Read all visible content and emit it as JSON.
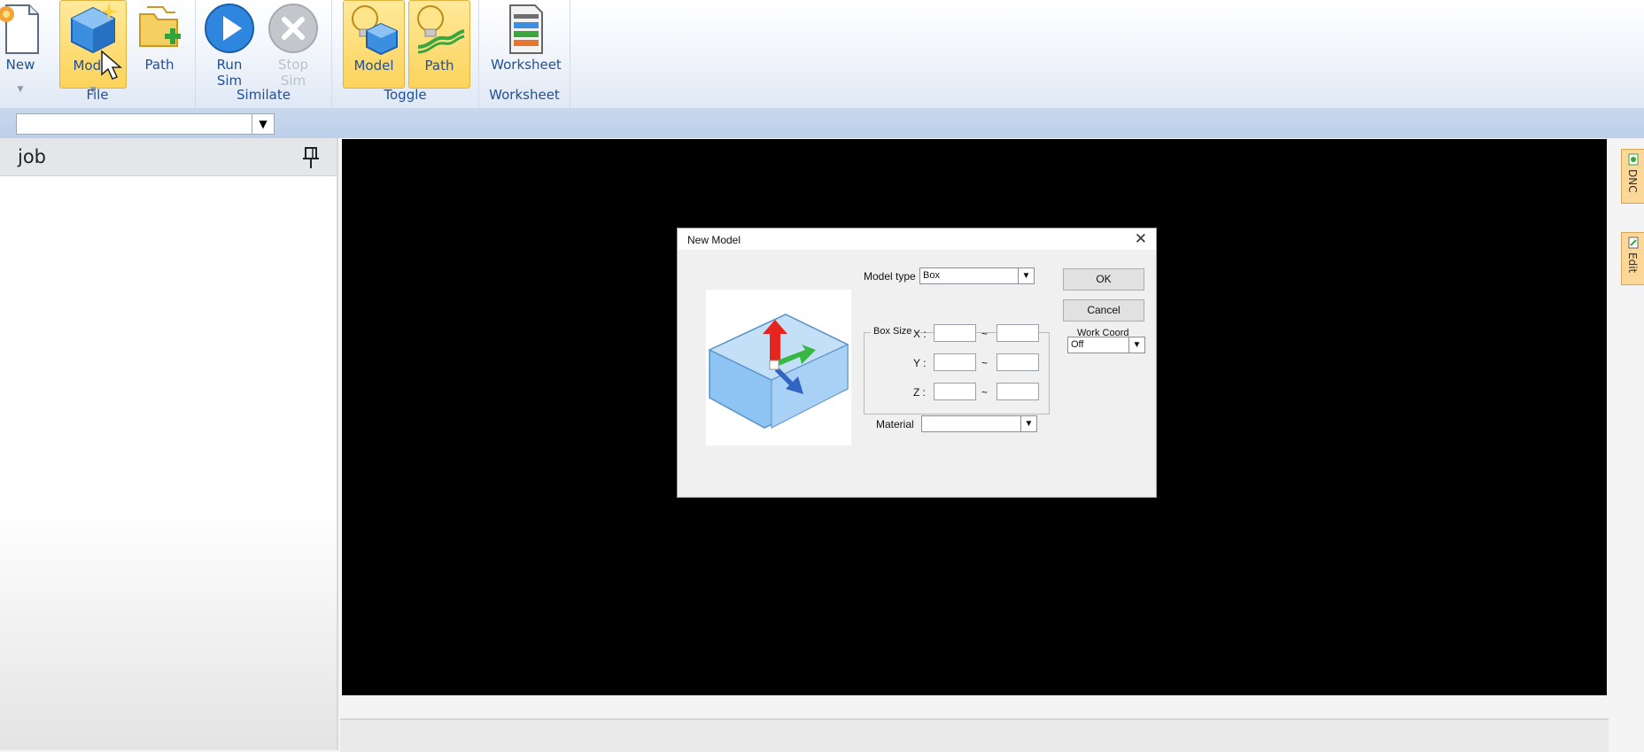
{
  "ribbon": {
    "file": {
      "label": "File",
      "new": "New",
      "model": "Model",
      "path": "Path"
    },
    "simulate": {
      "label": "Similate",
      "run_1": "Run",
      "run_2": "Sim",
      "stop_1": "Stop",
      "stop_2": "Sim"
    },
    "toggle": {
      "label": "Toggle",
      "model": "Model",
      "path": "Path"
    },
    "worksheet": {
      "label": "Worksheet",
      "worksheet": "Worksheet"
    }
  },
  "panel": {
    "title": "job"
  },
  "side_tabs": [
    "DNC",
    "Edit"
  ],
  "dialog": {
    "title": "New Model",
    "model_type_label": "Model type",
    "model_type_value": "Box",
    "box_size_label": "Box Size",
    "axes": [
      "X :",
      "Y :",
      "Z :"
    ],
    "range_sep": "~",
    "material_label": "Material",
    "material_value": "",
    "ok": "OK",
    "cancel": "Cancel",
    "work_coord_label": "Work Coord",
    "work_coord_value": "Off"
  },
  "colors": {
    "ribbon_text": "#1f4f96",
    "active_toggle": "#fcd35b",
    "viewport": "#000000"
  }
}
